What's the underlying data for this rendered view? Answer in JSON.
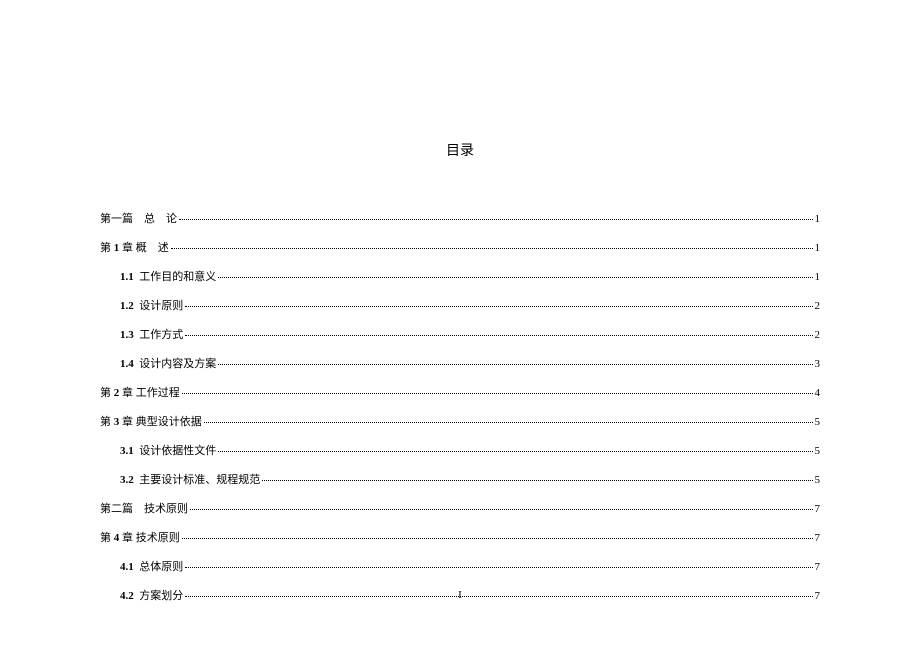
{
  "title": "目录",
  "page_footer": "I",
  "entries": [
    {
      "level": 0,
      "label": "第一篇 总 论",
      "page": "1"
    },
    {
      "level": 1,
      "label_html": "第 <span class=\"bold-num\">1</span> 章 概 述",
      "page": "1"
    },
    {
      "level": 2,
      "label_html": "<span class=\"bold-num\">1.1</span> 工作目的和意义",
      "page": "1"
    },
    {
      "level": 2,
      "label_html": "<span class=\"bold-num\">1.2</span> 设计原则",
      "page": "2"
    },
    {
      "level": 2,
      "label_html": "<span class=\"bold-num\">1.3</span> 工作方式",
      "page": "2"
    },
    {
      "level": 2,
      "label_html": "<span class=\"bold-num\">1.4</span> 设计内容及方案",
      "page": "3"
    },
    {
      "level": 1,
      "label_html": "第 <span class=\"bold-num\">2</span> 章 工作过程",
      "page": "4"
    },
    {
      "level": 1,
      "label_html": "第 <span class=\"bold-num\">3</span> 章 典型设计依据",
      "page": "5"
    },
    {
      "level": 2,
      "label_html": "<span class=\"bold-num\">3.1</span> 设计依据性文件",
      "page": "5"
    },
    {
      "level": 2,
      "label_html": "<span class=\"bold-num\">3.2</span> 主要设计标准、规程规范",
      "page": "5"
    },
    {
      "level": 0,
      "label": "第二篇 技术原则",
      "page": "7"
    },
    {
      "level": 1,
      "label_html": "第 <span class=\"bold-num\">4</span> 章 技术原则",
      "page": "7"
    },
    {
      "level": 2,
      "label_html": "<span class=\"bold-num\">4.1</span> 总体原则",
      "page": "7"
    },
    {
      "level": 2,
      "label_html": "<span class=\"bold-num\">4.2</span> 方案划分",
      "page": "7"
    }
  ]
}
